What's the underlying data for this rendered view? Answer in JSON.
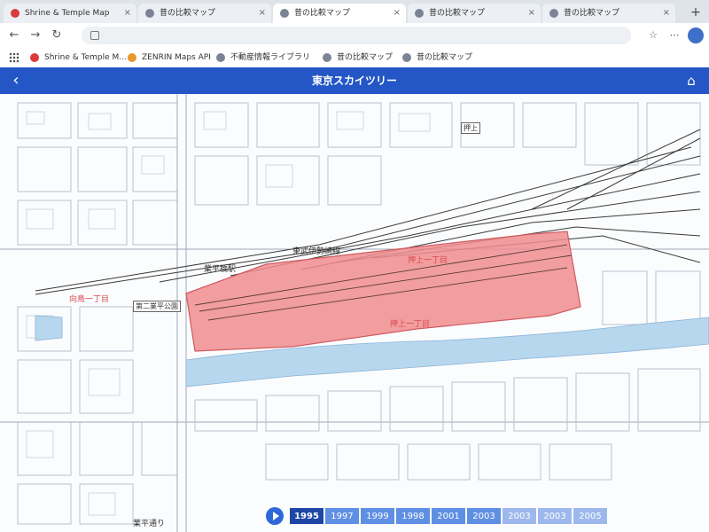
{
  "browser": {
    "tabs": [
      {
        "label": "Shrine & Temple Map",
        "active": false,
        "favicon": "red-pin-icon"
      },
      {
        "label": "昔の比較マップ",
        "active": false,
        "favicon": "globe-icon"
      },
      {
        "label": "昔の比較マップ",
        "active": true,
        "favicon": "globe-icon"
      },
      {
        "label": "昔の比較マップ",
        "active": false,
        "favicon": "globe-icon"
      },
      {
        "label": "昔の比較マップ",
        "active": false,
        "favicon": "globe-icon"
      }
    ],
    "new_tab": "+",
    "close_glyph": "×",
    "bookmarks": [
      {
        "label": "Shrine & Temple M…",
        "favicon": "red-pin-icon"
      },
      {
        "label": "ZENRIN Maps API",
        "favicon": "orange-icon"
      },
      {
        "label": "不動産情報ライブラリ",
        "favicon": "globe-icon"
      },
      {
        "label": "昔の比較マップ",
        "favicon": "globe-icon"
      },
      {
        "label": "昔の比較マップ",
        "favicon": "globe-icon"
      }
    ]
  },
  "app": {
    "title": "東京スカイツリー",
    "back_icon": "chevron-left-icon",
    "home_icon": "home-icon",
    "header_color": "#2457c5"
  },
  "map": {
    "highlight_color": "#f08c8e",
    "labels": {
      "station": "東武伊勢崎線",
      "area1": "押上一丁目",
      "area2": "押上一丁目",
      "area3": "向島一丁目",
      "hashi": "業平橋駅",
      "park": "第二業平公園",
      "tsu": "業平通り",
      "boxlabel": "押上"
    }
  },
  "timeline": {
    "selected_year": "1995",
    "years": [
      "1995",
      "1997",
      "1999",
      "1998",
      "2001",
      "2003",
      "2003",
      "2003",
      "2005"
    ]
  }
}
